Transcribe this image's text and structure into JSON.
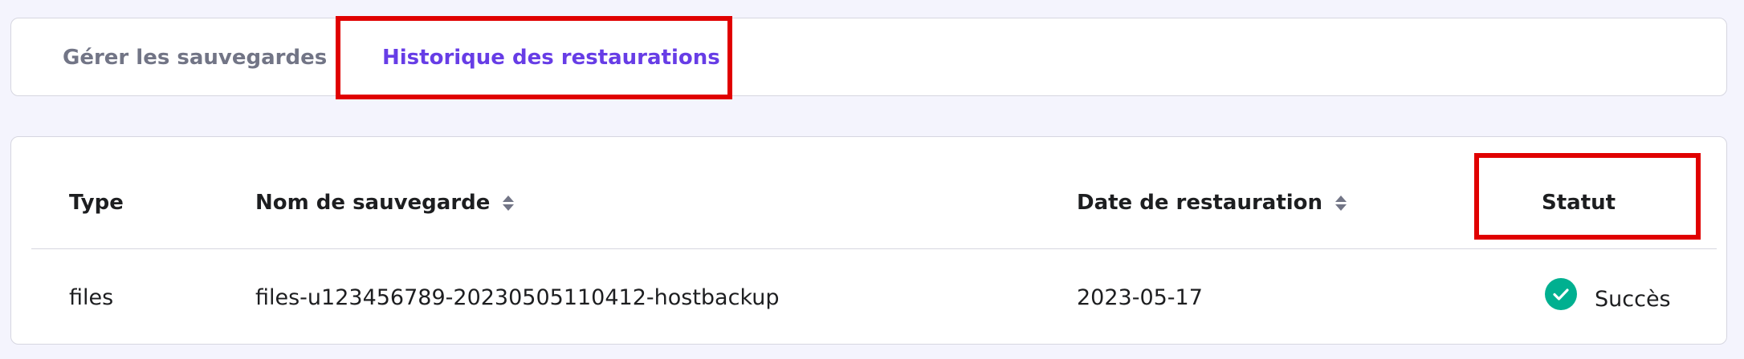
{
  "tabs": [
    {
      "label": "Gérer les sauvegardes",
      "active": false
    },
    {
      "label": "Historique des restaurations",
      "active": true
    }
  ],
  "table": {
    "columns": {
      "type": "Type",
      "name": "Nom de sauvegarde",
      "date": "Date de restauration",
      "status": "Statut"
    },
    "rows": [
      {
        "type": "files",
        "name": "files-u123456789-20230505110412-hostbackup",
        "date": "2023-05-17",
        "status": "Succès"
      }
    ]
  },
  "colors": {
    "accent": "#673de6",
    "highlight": "#e00000",
    "success": "#00b090",
    "muted": "#727586",
    "background": "#f4f4fd"
  }
}
